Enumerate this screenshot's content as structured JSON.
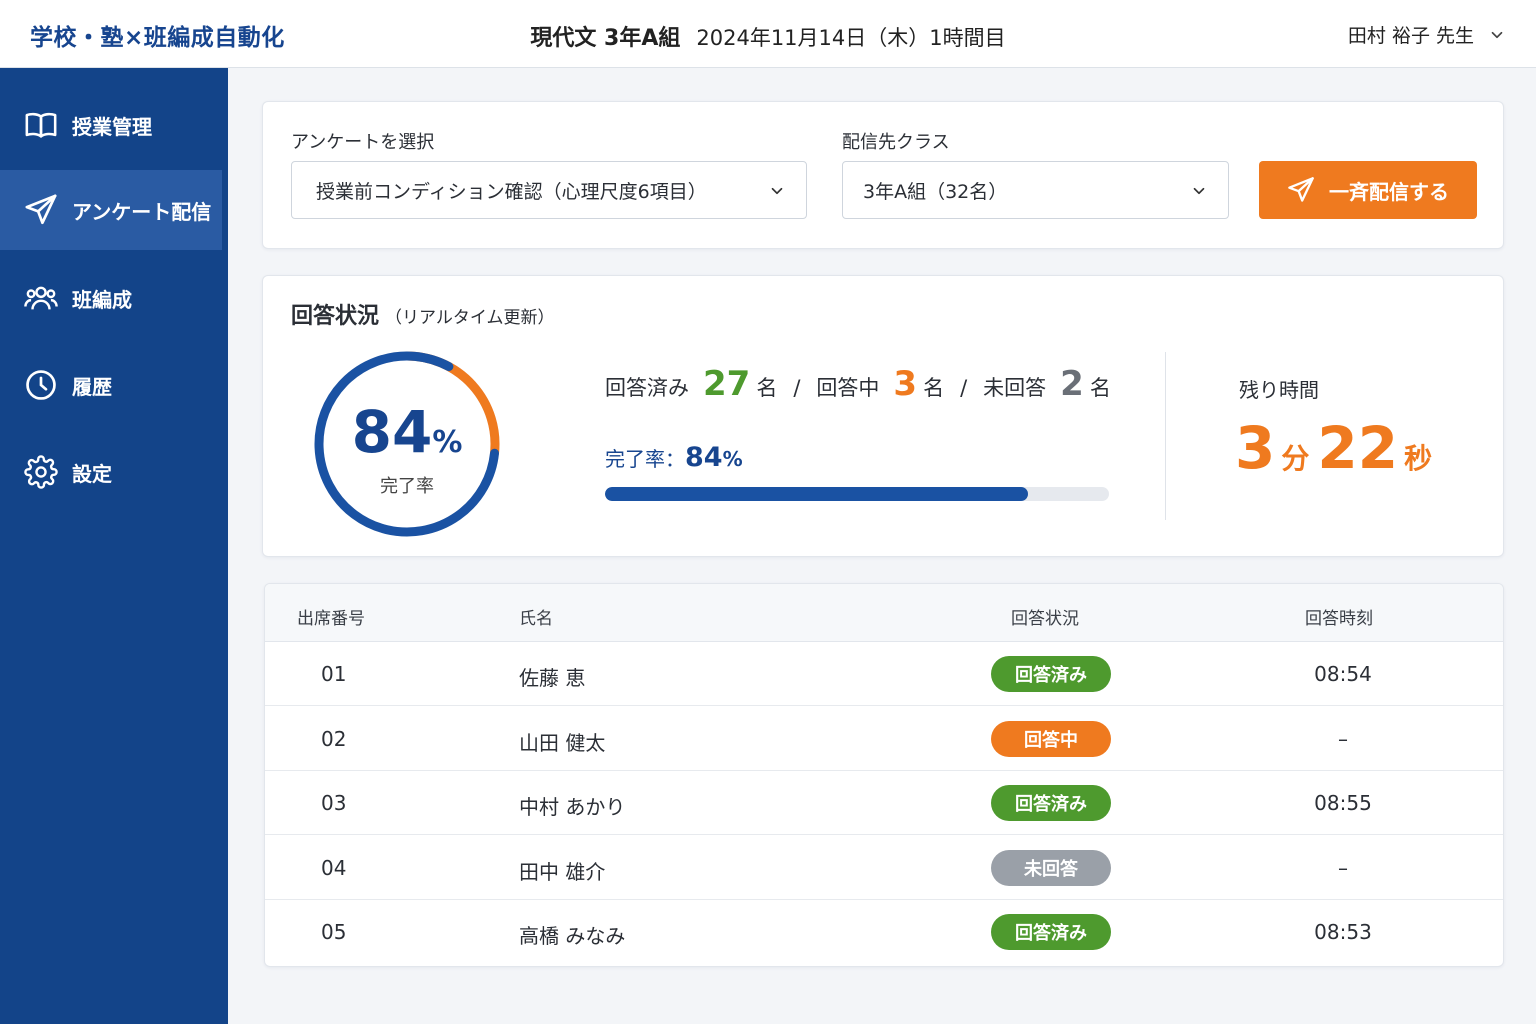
{
  "app": {
    "brand": "学校・塾×班編成自動化"
  },
  "header": {
    "class_name": "現代文 3年A組",
    "date_period": "2024年11月14日（木）1時間目",
    "user": "田村 裕子 先生"
  },
  "sidebar": {
    "items": [
      {
        "label": "授業管理",
        "icon": "book-icon",
        "active": false
      },
      {
        "label": "アンケート配信",
        "icon": "send-icon",
        "active": true
      },
      {
        "label": "班編成",
        "icon": "users-icon",
        "active": false
      },
      {
        "label": "履歴",
        "icon": "clock-icon",
        "active": false
      },
      {
        "label": "設定",
        "icon": "gear-icon",
        "active": false
      }
    ]
  },
  "survey": {
    "select_label": "アンケートを選択",
    "selected_survey": "授業前コンディション確認（心理尺度6項目）",
    "class_label": "配信先クラス",
    "selected_class": "3年A組（32名）",
    "send_button": "一斉配信する"
  },
  "status": {
    "title": "回答状況",
    "subtitle": "（リアルタイム更新）",
    "completion_value": "84",
    "percent_sign": "%",
    "completion_label": "完了率",
    "completion_fraction": 0.84,
    "answered_label": "回答済み",
    "answered_count": "27",
    "in_progress_label": "回答中",
    "in_progress_count": "3",
    "unanswered_label": "未回答",
    "unanswered_count": "2",
    "count_unit": "名",
    "separator": "/",
    "rate_label": "完了率：",
    "rate_value": "84",
    "remaining_label": "残り時間",
    "remaining_min": "3",
    "min_unit": "分",
    "remaining_sec": "22",
    "sec_unit": "秒"
  },
  "colors": {
    "primary": "#134489",
    "accent": "#ef7a1f",
    "answered": "#4e9a2e",
    "in_progress": "#ef7a1f",
    "unanswered": "#9aa0a8"
  },
  "table": {
    "headers": {
      "number": "出席番号",
      "name": "氏名",
      "status": "回答状況",
      "time": "回答時刻"
    },
    "rows": [
      {
        "number": "01",
        "name": "佐藤 恵",
        "status": "回答済み",
        "status_type": "answered",
        "time": "08:54"
      },
      {
        "number": "02",
        "name": "山田 健太",
        "status": "回答中",
        "status_type": "in_progress",
        "time": "–"
      },
      {
        "number": "03",
        "name": "中村 あかり",
        "status": "回答済み",
        "status_type": "answered",
        "time": "08:55"
      },
      {
        "number": "04",
        "name": "田中 雄介",
        "status": "未回答",
        "status_type": "unanswered",
        "time": "–"
      },
      {
        "number": "05",
        "name": "高橋 みなみ",
        "status": "回答済み",
        "status_type": "answered",
        "time": "08:53"
      }
    ]
  }
}
